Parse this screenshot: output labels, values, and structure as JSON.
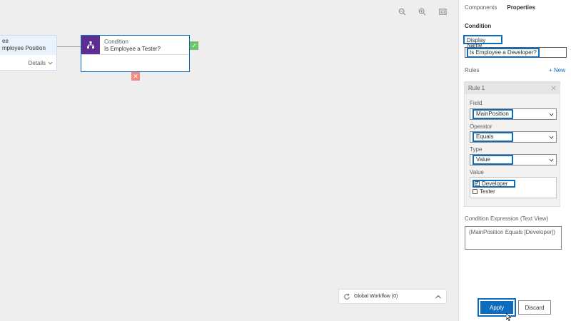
{
  "canvas": {
    "previous_node": {
      "line1": "ee",
      "line2": "mployee Position",
      "details_label": "Details"
    },
    "condition_node": {
      "title": "Condition",
      "subtitle": "Is Employee a Tester?"
    },
    "global_workflow_label": "Global Workflow (0)"
  },
  "panel": {
    "tabs": [
      {
        "label": "Components"
      },
      {
        "label": "Properties"
      }
    ],
    "section_title": "Condition",
    "display_name": {
      "label": "Display Name",
      "value": "Is Employee a Developer?"
    },
    "rules": {
      "label": "Rules",
      "new_label": "+ New",
      "rule": {
        "title": "Rule 1",
        "field": {
          "label": "Field",
          "value": "MainPosition"
        },
        "operator": {
          "label": "Operator",
          "value": "Equals"
        },
        "type": {
          "label": "Type",
          "value": "Value"
        },
        "value": {
          "label": "Value",
          "options": [
            {
              "label": "Developer",
              "checked": true
            },
            {
              "label": "Tester",
              "checked": false
            }
          ]
        }
      }
    },
    "expression": {
      "label": "Condition Expression (Text View)",
      "value": "(MainPosition Equals [Developer])"
    },
    "apply_label": "Apply",
    "discard_label": "Discard"
  },
  "colors": {
    "accent": "#0f6cbd",
    "condition_icon": "#5c2e91",
    "true_badge": "#6ec56e",
    "false_badge": "#f08a7e"
  }
}
